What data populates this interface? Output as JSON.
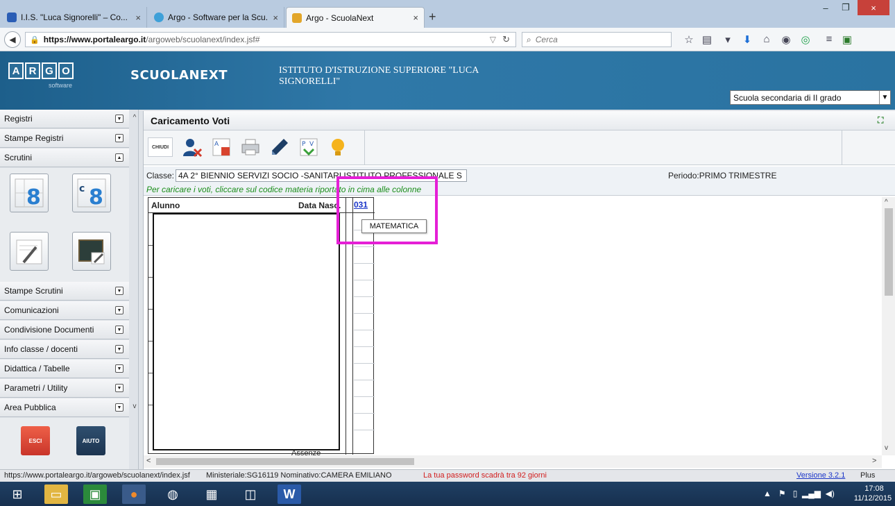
{
  "browser": {
    "tabs": [
      {
        "label": "I.I.S. \"Luca Signorelli\" – Co...",
        "close": "×"
      },
      {
        "label": "Argo - Software per la Scu...",
        "close": "×"
      },
      {
        "label": "Argo - ScuolaNext",
        "close": "×"
      }
    ],
    "new_tab": "+",
    "url_domain": "https://www.portaleargo.it",
    "url_path": "/argoweb/scuolanext/index.jsf#",
    "search_placeholder": "Cerca",
    "window_min": "–",
    "window_max": "❐",
    "window_close": "×"
  },
  "header": {
    "logo_letters": [
      "A",
      "R",
      "G",
      "O"
    ],
    "logo_sub": "software",
    "product": "SCUOLANEXT",
    "school_name": "ISTITUTO D'ISTRUZIONE SUPERIORE \"LUCA SIGNORELLI\"",
    "school_select": "Scuola secondaria di II grado"
  },
  "sidebar": {
    "top_items": [
      {
        "label": "Registri"
      },
      {
        "label": "Stampe Registri"
      },
      {
        "label": "Scrutini"
      }
    ],
    "bottom_items": [
      {
        "label": "Stampe Scrutini"
      },
      {
        "label": "Comunicazioni"
      },
      {
        "label": "Condivisione Documenti"
      },
      {
        "label": "Info classe / docenti"
      },
      {
        "label": "Didattica / Tabelle"
      },
      {
        "label": "Parametri / Utility"
      },
      {
        "label": "Area Pubblica"
      }
    ],
    "exit_label": "ESCI",
    "help_label": "AIUTO"
  },
  "main": {
    "title": "Caricamento Voti",
    "close_label": "CHIUDI",
    "class_label": "Classe:",
    "class_value": "4A 2° BIENNIO SERVIZI SOCIO -SANITARI ISTITUTO PROFESSIONALE S",
    "periodo": "Periodo:PRIMO TRIMESTRE",
    "hint": "Per caricare i voti, cliccare sul codice materia riportato in cima alle colonne",
    "grid": {
      "col_alunno": "Alunno",
      "col_data": "Data Nasc.",
      "col_code": "031",
      "footer": "Assenze"
    },
    "tooltip": "MATEMATICA"
  },
  "status": {
    "url": "https://www.portaleargo.it/argoweb/scuolanext/index.jsf",
    "info": "Ministeriale:SG16119 Nominativo:CAMERA EMILIANO",
    "warn": "La tua password scadrà tra 92 giorni",
    "version": "Versione 3.2.1",
    "plus": "Plus"
  },
  "taskbar": {
    "time": "17:08",
    "date": "11/12/2015"
  },
  "colors": {
    "highlight": "#e51fd6",
    "header_blue": "#2f78a8",
    "hint_green": "#1a8d1a",
    "warn_red": "#d21d1d",
    "link_blue": "#1a35c8"
  }
}
